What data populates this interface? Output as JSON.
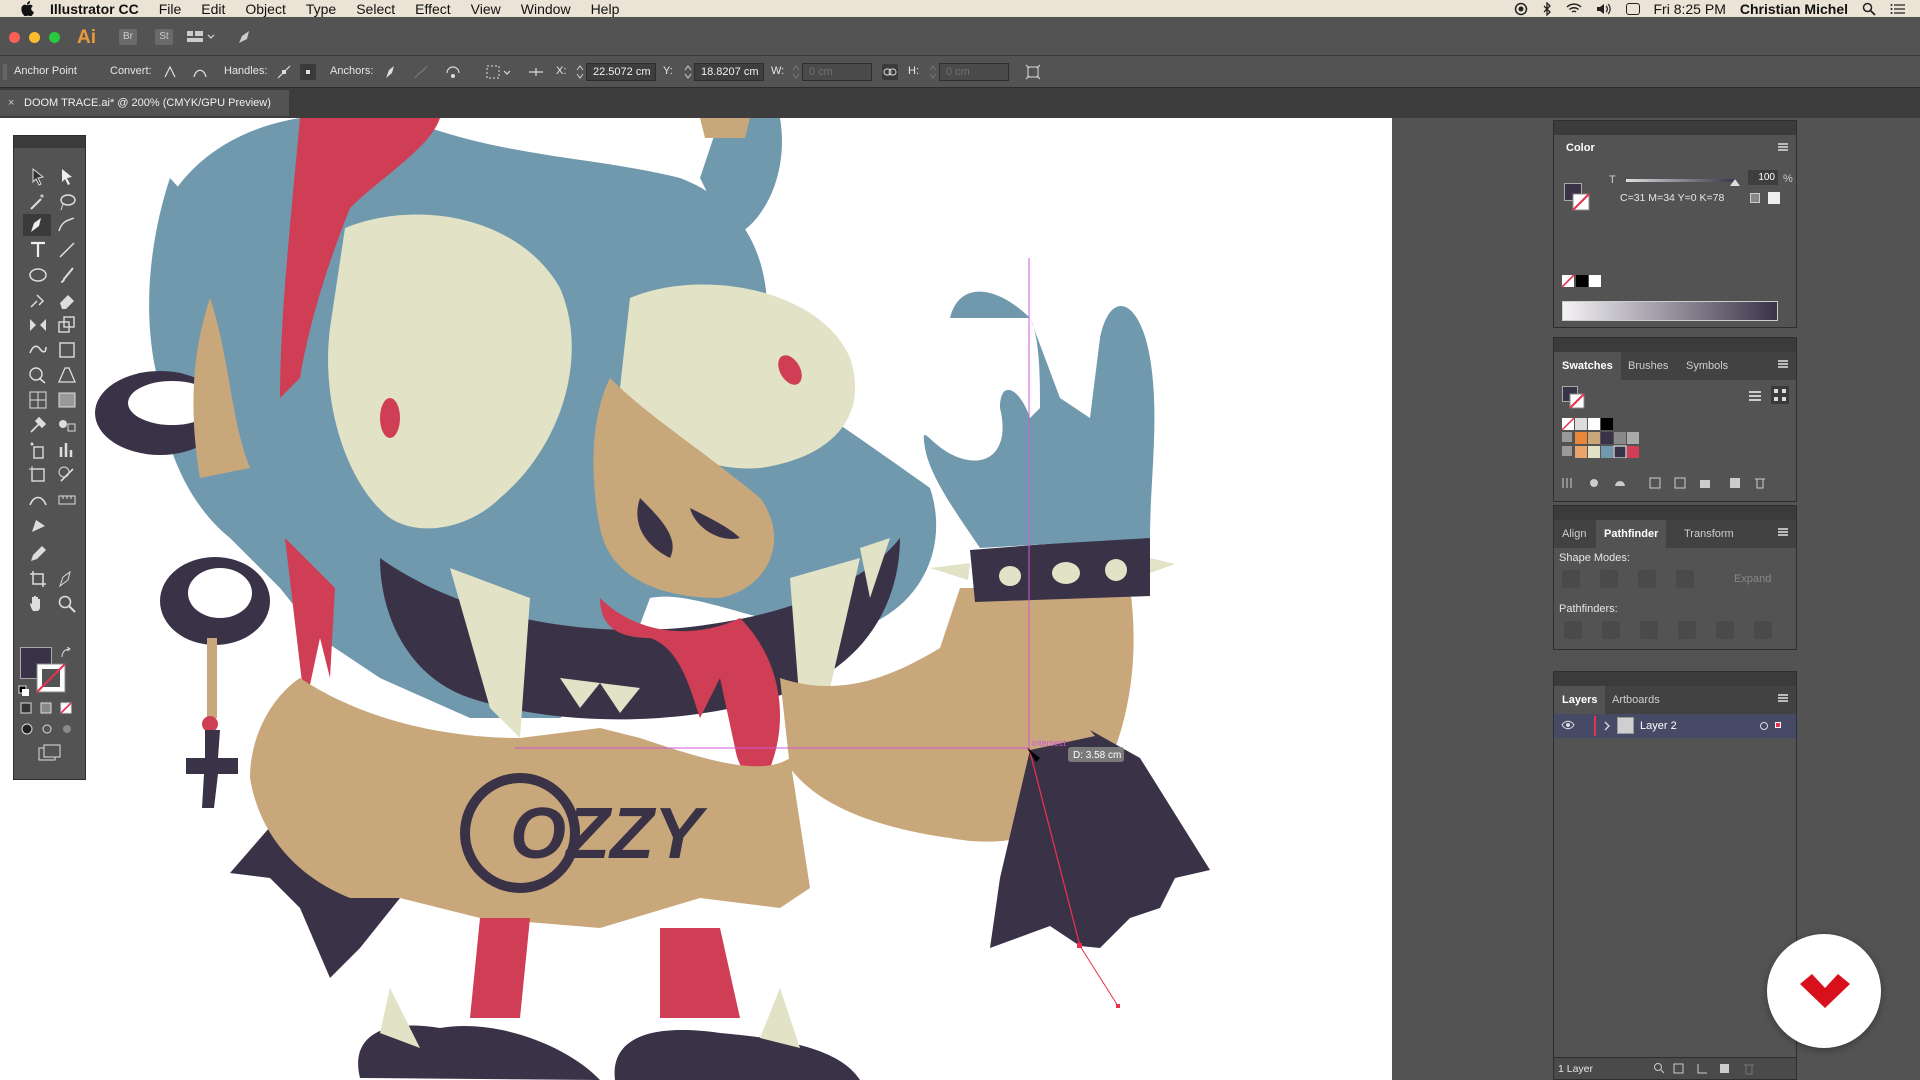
{
  "menubar": {
    "app_name": "Illustrator CC",
    "items": [
      "File",
      "Edit",
      "Object",
      "Type",
      "Select",
      "Effect",
      "View",
      "Window",
      "Help"
    ],
    "clock": "Fri 8:25 PM",
    "user": "Christian Michel"
  },
  "appbar": {
    "logo": "Ai",
    "bridge": "Br",
    "stock": "St"
  },
  "controlbar": {
    "mode_label": "Anchor Point",
    "convert_label": "Convert:",
    "handles_label": "Handles:",
    "anchors_label": "Anchors:",
    "x_label": "X:",
    "x_value": "22.5072 cm",
    "y_label": "Y:",
    "y_value": "18.8207 cm",
    "w_label": "W:",
    "w_value": "0 cm",
    "h_label": "H:",
    "h_value": "0 cm"
  },
  "document": {
    "tab_title": "DOOM TRACE.ai* @ 200% (CMYK/GPU Preview)",
    "close": "×"
  },
  "canvas": {
    "smart_guide_label": "intersect",
    "distance_tooltip": "D: 3.58 cm",
    "shirt_text": "OZZY"
  },
  "color_panel": {
    "title": "Color",
    "tint_label": "T",
    "tint_value": "100",
    "percent": "%",
    "cmyk_readout": "C=31 M=34 Y=0 K=78"
  },
  "swatches_panel": {
    "tabs": [
      "Swatches",
      "Brushes",
      "Symbols"
    ]
  },
  "pathfinder_panel": {
    "tabs": [
      "Align",
      "Pathfinder",
      "Transform"
    ],
    "shape_modes_label": "Shape Modes:",
    "expand_label": "Expand",
    "pathfinders_label": "Pathfinders:"
  },
  "layers_panel": {
    "tabs": [
      "Layers",
      "Artboards"
    ],
    "layer_name": "Layer 2",
    "footer_count": "1 Layer"
  },
  "colors": {
    "accent_blue": "#7099ae",
    "cream": "#e2e3c6",
    "tan": "#c8a77b",
    "red": "#cf3e54",
    "dark": "#3a3348",
    "guide_magenta": "#d357d6",
    "path_red": "#e8314e",
    "watermark_red": "#d8101c"
  }
}
